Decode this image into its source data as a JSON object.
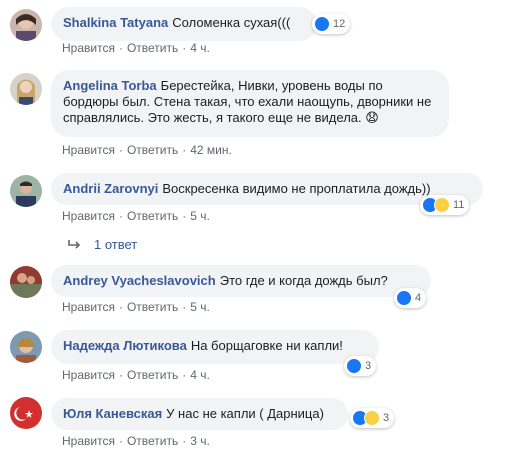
{
  "comments": [
    {
      "author": "Shalkina Tatyana",
      "text": "Соломенка сухая(((",
      "like_label": "Нравится",
      "reply_label": "Ответить",
      "time": "4 ч.",
      "reactions": [
        "like"
      ],
      "reaction_count": "12"
    },
    {
      "author": "Angelina Torba",
      "text": "Берестейка, Нивки, уровень воды по бордюры был. Стена такая, что ехали наощупь, дворники не справлялись. Это жесть, я такого еще не видела. 😧",
      "like_label": "Нравится",
      "reply_label": "Ответить",
      "time": "42 мин.",
      "reactions": [],
      "reaction_count": ""
    },
    {
      "author": "Andrii Zarovnyi",
      "text": "Воскресенка видимо не проплатила дождь))",
      "like_label": "Нравится",
      "reply_label": "Ответить",
      "time": "5 ч.",
      "reactions": [
        "like",
        "haha"
      ],
      "reaction_count": "11"
    },
    {
      "author": "Andrey Vyacheslavovich",
      "text": "Это где и когда дождь был?",
      "like_label": "Нравится",
      "reply_label": "Ответить",
      "time": "5 ч.",
      "reactions": [
        "like"
      ],
      "reaction_count": "4"
    },
    {
      "author": "Надежда Лютикова",
      "text": "На борщаговке ни капли!",
      "like_label": "Нравится",
      "reply_label": "Ответить",
      "time": "4 ч.",
      "reactions": [
        "like"
      ],
      "reaction_count": "3"
    },
    {
      "author": "Юля Каневская",
      "text": "У нас не капли ( Дарница)",
      "like_label": "Нравится",
      "reply_label": "Ответить",
      "time": "3 ч.",
      "reactions": [
        "like",
        "wow"
      ],
      "reaction_count": "3"
    }
  ],
  "replies_link": "1 ответ",
  "colors": {
    "author": "#385898",
    "bubble": "#f2f3f5",
    "meta": "#606770",
    "like": "#1877f2",
    "emoji": "#f7d046"
  }
}
